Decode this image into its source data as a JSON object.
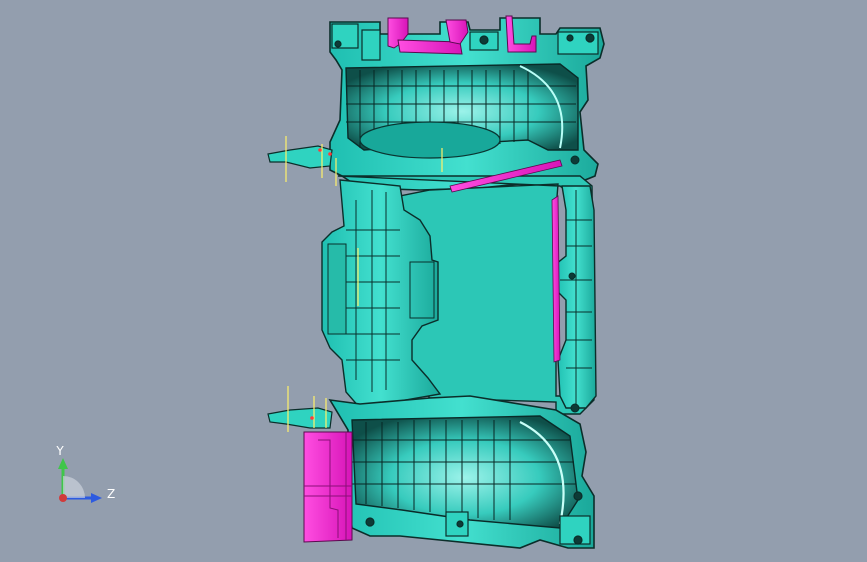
{
  "viewport": {
    "colors": {
      "background": "#939eae",
      "part_primary": "#2fd3c0",
      "part_dark": "#0f3f3a",
      "part_highlight": "#e6ff56",
      "accent_magenta": "#ff2ad7",
      "guide_yellow": "#fff26a",
      "axis_x": "#d13b3b",
      "axis_y": "#3fc64a",
      "axis_z": "#2d5be0"
    }
  },
  "triad": {
    "y_label": "Y",
    "z_label": "Z",
    "y_icon": "arrow-up-icon",
    "z_icon": "arrow-right-icon",
    "origin_icon": "dot-icon"
  }
}
